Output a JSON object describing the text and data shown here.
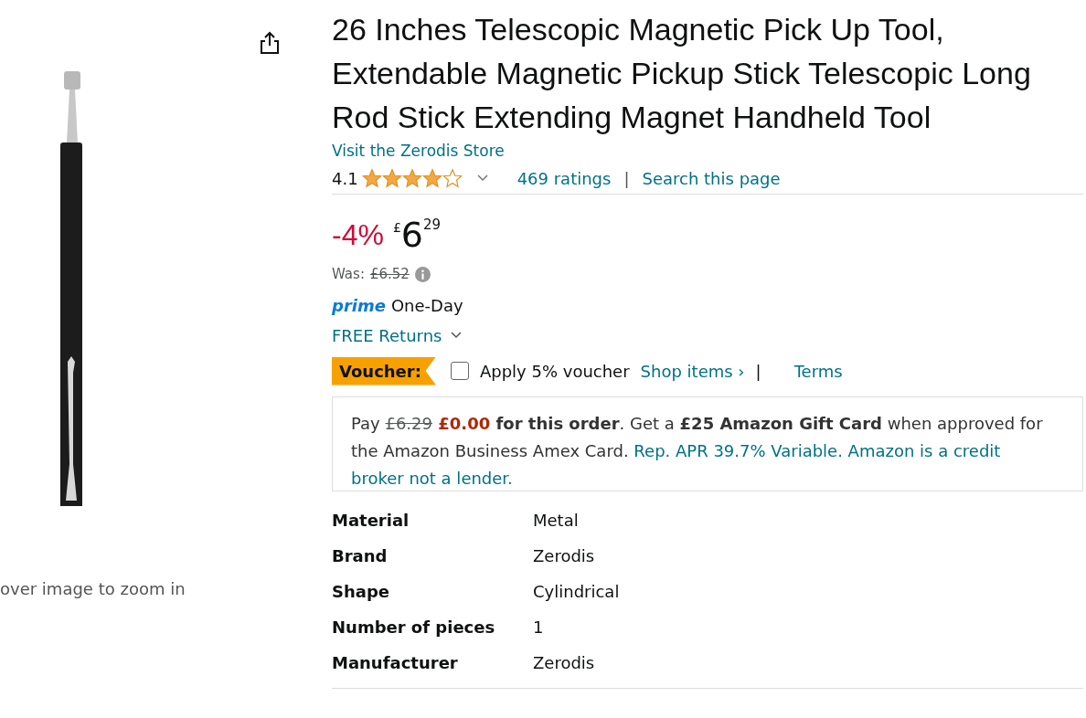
{
  "image_panel": {
    "zoom_hint": "over image to zoom in"
  },
  "product": {
    "title": "26 Inches Telescopic Magnetic Pick Up Tool, Extendable Magnetic Pickup Stick Telescopic Long Rod Stick Extending Magnet Handheld Tool",
    "store_link": "Visit the Zerodis Store",
    "rating": "4.1",
    "stars": 4,
    "ratings_link": "469 ratings",
    "separator": "|",
    "search_link": "Search this page",
    "discount": "-4%",
    "currency": "£",
    "price_whole": "6",
    "price_fraction": "29",
    "was_label": "Was:",
    "was_price": "£6.52",
    "prime": "prime",
    "delivery": "One-Day",
    "returns": "FREE Returns",
    "voucher": {
      "badge": "Voucher:",
      "checked": false,
      "label": "Apply 5% voucher",
      "shop_link": "Shop items ›",
      "separator": "|",
      "terms_link": "Terms"
    },
    "promo": [
      {
        "kind": "plain",
        "text": "Pay "
      },
      {
        "kind": "strike",
        "text": "£6.29"
      },
      {
        "kind": "price",
        "text": " £0.00"
      },
      {
        "kind": "bold",
        "text": " for this order"
      },
      {
        "kind": "plain",
        "text": ". Get a "
      },
      {
        "kind": "bold",
        "text": "£25 Amazon Gift Card"
      },
      {
        "kind": "plain",
        "text": " when approved for the Amazon Business Amex Card. "
      },
      {
        "kind": "link",
        "text": "Rep. APR 39.7% Variable. Amazon is a credit broker not a lender."
      }
    ],
    "specs": [
      {
        "name": "Material",
        "value": "Metal"
      },
      {
        "name": "Brand",
        "value": "Zerodis"
      },
      {
        "name": "Shape",
        "value": "Cylindrical"
      },
      {
        "name": "Number of pieces",
        "value": "1"
      },
      {
        "name": "Manufacturer",
        "value": "Zerodis"
      }
    ]
  }
}
